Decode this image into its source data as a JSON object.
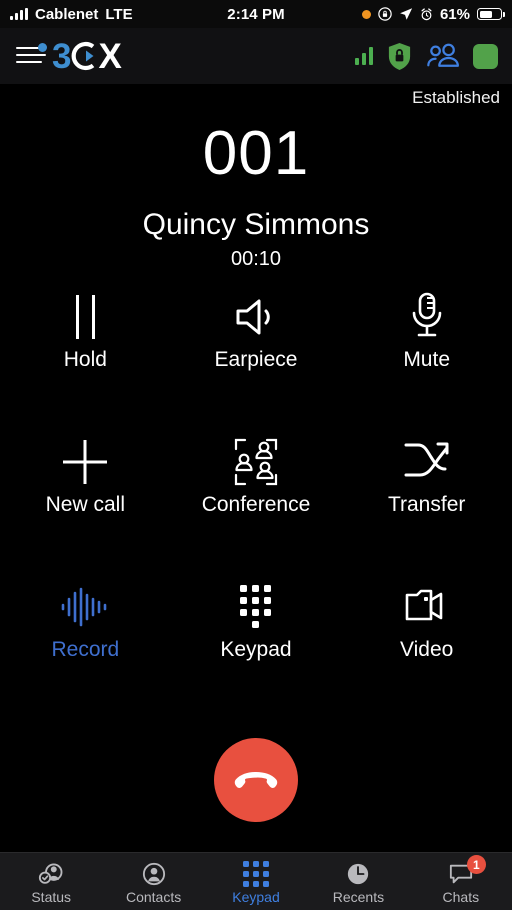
{
  "status_bar": {
    "carrier": "Cablenet",
    "network": "LTE",
    "time": "2:14 PM",
    "battery_percent": "61%",
    "icons": [
      "signal-bars-icon",
      "orange-recording-dot-icon",
      "rotation-lock-icon",
      "location-arrow-icon",
      "alarm-clock-icon",
      "battery-icon"
    ]
  },
  "app_header": {
    "menu_icon": "hamburger-menu-icon",
    "logo": {
      "part1": "3",
      "part2": "C",
      "part3": "X"
    },
    "right_icons": [
      "signal-strength-icon",
      "secure-shield-lock-icon",
      "group-contacts-icon",
      "presence-status-square"
    ],
    "colors": {
      "logo_blue": "#3e8ed0",
      "green": "#52a24a",
      "blue": "#3f7fe0"
    }
  },
  "call": {
    "status": "Established",
    "number": "001",
    "name": "Quincy Simmons",
    "duration": "00:10"
  },
  "controls": [
    {
      "label": "Hold",
      "icon": "pause-icon",
      "active": false
    },
    {
      "label": "Earpiece",
      "icon": "speaker-icon",
      "active": false
    },
    {
      "label": "Mute",
      "icon": "microphone-icon",
      "active": false
    },
    {
      "label": "New call",
      "icon": "plus-icon",
      "active": false
    },
    {
      "label": "Conference",
      "icon": "conference-icon",
      "active": false
    },
    {
      "label": "Transfer",
      "icon": "transfer-arrow-icon",
      "active": false
    },
    {
      "label": "Record",
      "icon": "waveform-icon",
      "active": true
    },
    {
      "label": "Keypad",
      "icon": "dialpad-icon",
      "active": false
    },
    {
      "label": "Video",
      "icon": "video-camera-icon",
      "active": false
    }
  ],
  "end_call": {
    "icon": "hangup-phone-icon",
    "color": "#e8503f"
  },
  "tabs": [
    {
      "label": "Status",
      "icon": "status-person-check-icon",
      "active": false,
      "badge": ""
    },
    {
      "label": "Contacts",
      "icon": "contacts-person-icon",
      "active": false,
      "badge": ""
    },
    {
      "label": "Keypad",
      "icon": "dialpad-icon",
      "active": true,
      "badge": ""
    },
    {
      "label": "Recents",
      "icon": "clock-icon",
      "active": false,
      "badge": ""
    },
    {
      "label": "Chats",
      "icon": "chat-bubble-icon",
      "active": false,
      "badge": "1"
    }
  ]
}
